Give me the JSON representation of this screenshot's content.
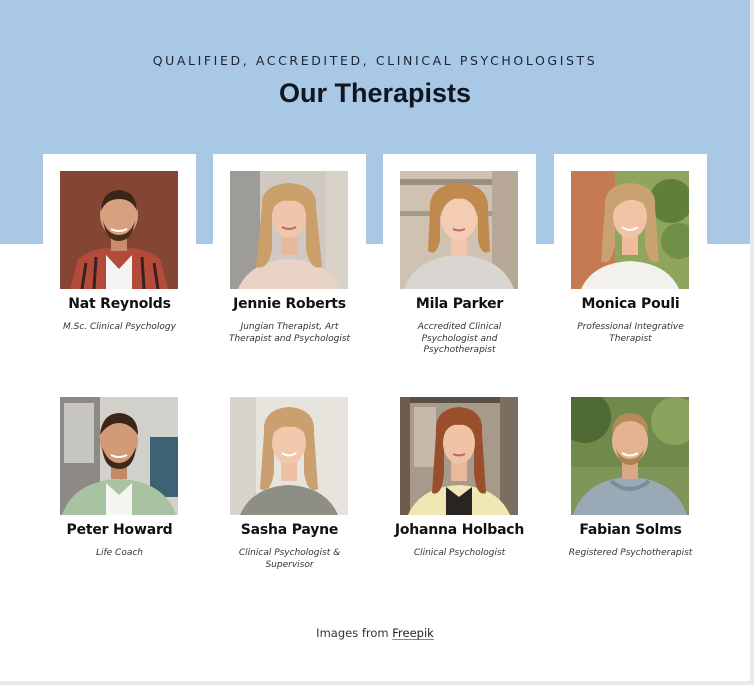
{
  "header": {
    "eyebrow": "QUALIFIED, ACCREDITED, CLINICAL PSYCHOLOGISTS",
    "title": "Our Therapists"
  },
  "therapists": [
    {
      "name": "Nat Reynolds",
      "role": "M.Sc. Clinical Psychology"
    },
    {
      "name": "Jennie Roberts",
      "role": "Jungian Therapist, Art Therapist and Psychologist"
    },
    {
      "name": "Mila Parker",
      "role": "Accredited Clinical Psychologist and Psychotherapist"
    },
    {
      "name": "Monica Pouli",
      "role": "Professional Integrative Therapist"
    },
    {
      "name": "Peter Howard",
      "role": "Life Coach"
    },
    {
      "name": "Sasha Payne",
      "role": "Clinical Psychologist & Supervisor"
    },
    {
      "name": "Johanna Holbach",
      "role": "Clinical Psychologist"
    },
    {
      "name": "Fabian Solms",
      "role": "Registered Psychotherapist"
    }
  ],
  "footer": {
    "credit_prefix": "Images from ",
    "credit_link": "Freepik"
  },
  "colors": {
    "hero_background": "#a9c8e6",
    "card_background": "#ffffff",
    "text_dark": "#0f1622"
  }
}
